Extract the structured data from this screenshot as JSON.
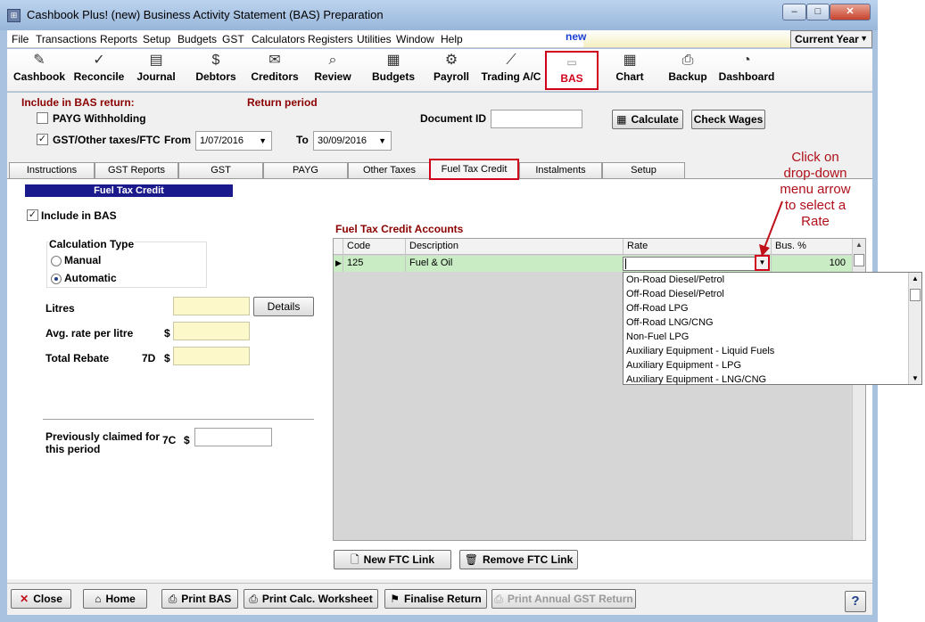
{
  "window": {
    "title": "Cashbook Plus! (new)  Business Activity Statement (BAS) Preparation",
    "minimize": "–",
    "maximize": "□",
    "close": "✕"
  },
  "menu": {
    "items": [
      "File",
      "Transactions",
      "Reports",
      "Setup",
      "Budgets",
      "GST",
      "Calculators",
      "Registers",
      "Utilities",
      "Window",
      "Help"
    ],
    "status": "new",
    "year_select": "Current Year"
  },
  "toolbar": {
    "items": [
      {
        "label": "Cashbook",
        "icon": "cashbook-icon"
      },
      {
        "label": "Reconcile",
        "icon": "check-icon"
      },
      {
        "label": "Journal",
        "icon": "journal-icon"
      },
      {
        "label": "Debtors",
        "icon": "dollar-icon"
      },
      {
        "label": "Creditors",
        "icon": "creditors-icon"
      },
      {
        "label": "Review",
        "icon": "magnifier-icon"
      },
      {
        "label": "Budgets",
        "icon": "budgets-icon"
      },
      {
        "label": "Payroll",
        "icon": "payroll-icon"
      },
      {
        "label": "Trading A/C",
        "icon": "chart-line-icon"
      },
      {
        "label": "BAS",
        "icon": "bas-icon"
      },
      {
        "label": "Chart",
        "icon": "grid-icon"
      },
      {
        "label": "Backup",
        "icon": "backup-icon"
      },
      {
        "label": "Dashboard",
        "icon": "gauge-icon"
      }
    ]
  },
  "header": {
    "include_label": "Include in BAS return:",
    "return_period_label": "Return period",
    "payg_label": "PAYG Withholding",
    "gst_label": "GST/Other taxes/FTC",
    "from_label": "From",
    "from_value": "1/07/2016",
    "to_label": "To",
    "to_value": "30/09/2016",
    "document_id_label": "Document ID",
    "document_id_value": "",
    "calculate_btn": "Calculate",
    "check_wages_btn": "Check Wages"
  },
  "tabs": [
    "Instructions",
    "GST Reports",
    "GST",
    "PAYG",
    "Other Taxes",
    "Fuel Tax Credit",
    "Instalments",
    "Setup"
  ],
  "ftc": {
    "section_title": "Fuel Tax Credit",
    "include_label": "Include in BAS",
    "calc_type_label": "Calculation Type",
    "manual_label": "Manual",
    "automatic_label": "Automatic",
    "litres_label": "Litres",
    "details_btn": "Details",
    "avg_rate_label": "Avg. rate per litre",
    "dollar": "$",
    "total_rebate_label": "Total Rebate",
    "code_7d": "7D",
    "prev_claimed_label_1": "Previously claimed for",
    "prev_claimed_label_2": "this period",
    "code_7c": "7C",
    "accounts_title": "Fuel Tax Credit Accounts",
    "columns": [
      "Code",
      "Description",
      "Rate",
      "Bus. %"
    ],
    "rows": [
      {
        "code": "125",
        "description": "Fuel & Oil",
        "rate": "",
        "bus_pct": "100"
      }
    ],
    "rate_options": [
      "On-Road Diesel/Petrol",
      "Off-Road Diesel/Petrol",
      "Off-Road LPG",
      "Off-Road LNG/CNG",
      "Non-Fuel LPG",
      "Auxiliary Equipment - Liquid Fuels",
      "Auxiliary Equipment - LPG",
      "Auxiliary Equipment - LNG/CNG"
    ],
    "new_link_btn": "New FTC Link",
    "remove_link_btn": "Remove FTC Link"
  },
  "annotation": {
    "line1": "Click on",
    "line2": "drop-down",
    "line3": "menu arrow",
    "line4": "to select a",
    "line5": "Rate"
  },
  "bottom": {
    "close_btn": "Close",
    "home_btn": "Home",
    "print_bas_btn": "Print BAS",
    "print_calc_btn": "Print Calc. Worksheet",
    "finalise_btn": "Finalise Return",
    "print_annual_btn": "Print Annual GST Return",
    "help_btn": "?"
  }
}
